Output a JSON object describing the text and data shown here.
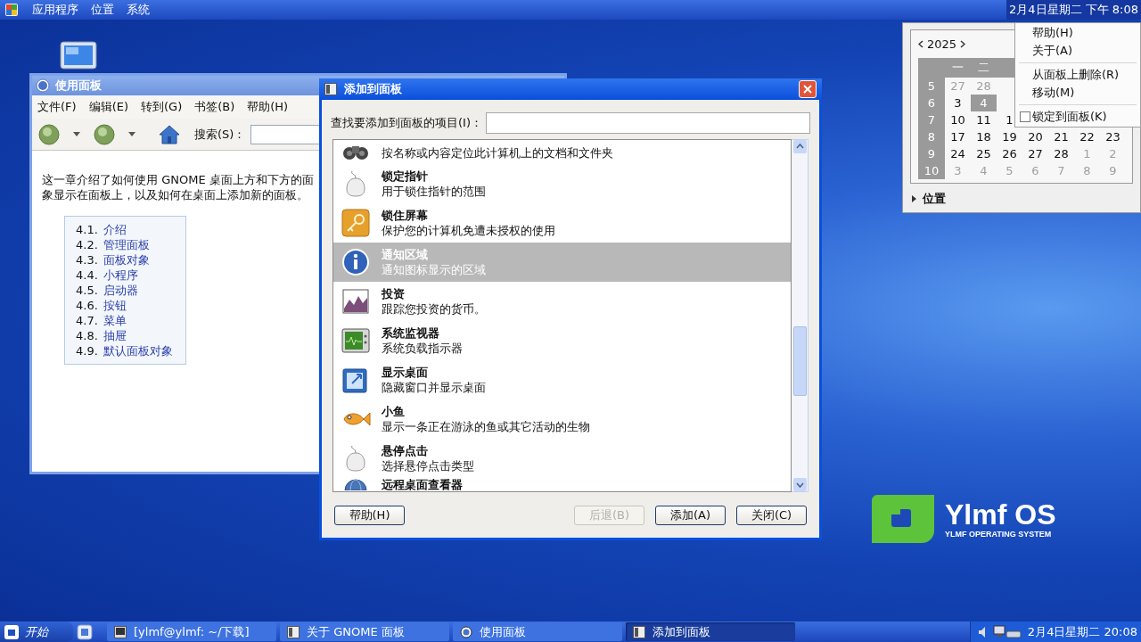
{
  "top_panel": {
    "menus": [
      "应用程序",
      "位置",
      "系统"
    ],
    "clock": "2月4日星期二 下午 8:08",
    "clock_pressed": true
  },
  "help_window": {
    "title": "使用面板",
    "menus": [
      "文件(F)",
      "编辑(E)",
      "转到(G)",
      "书签(B)",
      "帮助(H)"
    ],
    "search_label": "搜索(S)：",
    "paragraph_lines": [
      "这一章介绍了如何使用 GNOME 桌面上方和下方的面",
      "象显示在面板上，以及如何在桌面上添加新的面板。"
    ],
    "toc": [
      {
        "number": "4.1.",
        "label": "介绍"
      },
      {
        "number": "4.2.",
        "label": "管理面板"
      },
      {
        "number": "4.3.",
        "label": "面板对象"
      },
      {
        "number": "4.4.",
        "label": "小程序"
      },
      {
        "number": "4.5.",
        "label": "启动器"
      },
      {
        "number": "4.6.",
        "label": "按钮"
      },
      {
        "number": "4.7.",
        "label": "菜单"
      },
      {
        "number": "4.8.",
        "label": "抽屉"
      },
      {
        "number": "4.9.",
        "label": "默认面板对象"
      }
    ]
  },
  "dialog": {
    "title": "添加到面板",
    "search_label": "查找要添加到面板的项目(I)：",
    "items": [
      {
        "kind": "binoculars",
        "description": "按名称或内容定位此计算机上的文档和文件夹",
        "selected": false
      },
      {
        "kind": "mouse",
        "title": "锁定指针",
        "description": "用于锁住指针的范围",
        "selected": false
      },
      {
        "kind": "key",
        "title": "锁住屏幕",
        "description": "保护您的计算机免遭未授权的使用",
        "selected": false
      },
      {
        "kind": "info",
        "title": "通知区域",
        "description": "通知图标显示的区域",
        "selected": true
      },
      {
        "kind": "chart",
        "title": "投资",
        "description": "跟踪您投资的货币。",
        "selected": false
      },
      {
        "kind": "monitor",
        "title": "系统监视器",
        "description": "系统负载指示器",
        "selected": false
      },
      {
        "kind": "desktop",
        "title": "显示桌面",
        "description": "隐藏窗口并显示桌面",
        "selected": false
      },
      {
        "kind": "fish",
        "title": "小鱼",
        "description": "显示一条正在游泳的鱼或其它活动的生物",
        "selected": false
      },
      {
        "kind": "mouse",
        "title": "悬停点击",
        "description": "选择悬停点击类型",
        "selected": false
      },
      {
        "kind": "globe",
        "title": "远程桌面查看器",
        "selected": false
      }
    ],
    "buttons": [
      {
        "label": "帮助(H)",
        "disabled": false
      },
      {
        "label": "后退(B)",
        "disabled": true
      },
      {
        "label": "添加(A)",
        "disabled": false
      },
      {
        "label": "关闭(C)",
        "disabled": false
      }
    ]
  },
  "calendar": {
    "year": "2025",
    "weekdays": [
      "一",
      "二"
    ],
    "weeks": [
      {
        "number": "5",
        "days": [
          {
            "day": "27",
            "other_month": true,
            "selected": false
          },
          {
            "day": "28",
            "other_month": true,
            "selected": false
          }
        ]
      },
      {
        "number": "6",
        "days": [
          {
            "day": "3",
            "other_month": false,
            "selected": false
          },
          {
            "day": "4",
            "other_month": false,
            "selected": true
          }
        ]
      },
      {
        "number": "7",
        "days": [
          {
            "day": "10",
            "other_month": false,
            "selected": false
          },
          {
            "day": "11",
            "other_month": false,
            "selected": false
          },
          {
            "day": "1",
            "other_month": false,
            "selected": false
          }
        ]
      },
      {
        "number": "8",
        "days": [
          {
            "day": "17",
            "other_month": false,
            "selected": false
          },
          {
            "day": "18",
            "other_month": false,
            "selected": false
          },
          {
            "day": "19",
            "other_month": false,
            "selected": false
          },
          {
            "day": "20",
            "other_month": false,
            "selected": false
          },
          {
            "day": "21",
            "other_month": false,
            "selected": false
          },
          {
            "day": "22",
            "other_month": false,
            "selected": false
          },
          {
            "day": "23",
            "other_month": false,
            "selected": false
          }
        ]
      },
      {
        "number": "9",
        "days": [
          {
            "day": "24",
            "other_month": false,
            "selected": false
          },
          {
            "day": "25",
            "other_month": false,
            "selected": false
          },
          {
            "day": "26",
            "other_month": false,
            "selected": false
          },
          {
            "day": "27",
            "other_month": false,
            "selected": false
          },
          {
            "day": "28",
            "other_month": false,
            "selected": false
          },
          {
            "day": "1",
            "other_month": true,
            "selected": false
          },
          {
            "day": "2",
            "other_month": true,
            "selected": false
          }
        ]
      },
      {
        "number": "10",
        "days": [
          {
            "day": "3",
            "other_month": true,
            "selected": false
          },
          {
            "day": "4",
            "other_month": true,
            "selected": false
          },
          {
            "day": "5",
            "other_month": true,
            "selected": false
          },
          {
            "day": "6",
            "other_month": true,
            "selected": false
          },
          {
            "day": "7",
            "other_month": true,
            "selected": false
          },
          {
            "day": "8",
            "other_month": true,
            "selected": false
          },
          {
            "day": "9",
            "other_month": true,
            "selected": false
          }
        ]
      }
    ],
    "expander": {
      "label": "位置",
      "expanded": false
    }
  },
  "context_menu": {
    "items": [
      {
        "kind": "item",
        "label": "帮助(H)"
      },
      {
        "kind": "item",
        "label": "关于(A)"
      },
      {
        "kind": "separator"
      },
      {
        "kind": "item",
        "label": "从面板上删除(R)"
      },
      {
        "kind": "item",
        "label": "移动(M)"
      },
      {
        "kind": "separator"
      },
      {
        "kind": "check",
        "label": "锁定到面板(K)",
        "checked": false
      }
    ]
  },
  "logo": {
    "name": "Ylmf OS",
    "tagline": "YLMF OPERATING SYSTEM"
  },
  "taskbar": {
    "start": "开始",
    "tasks": [
      {
        "kind": "terminal",
        "label": "[ylmf@ylmf: ~/下载]",
        "selected": false
      },
      {
        "kind": "panel",
        "label": "关于 GNOME 面板",
        "selected": false
      },
      {
        "kind": "help",
        "label": "使用面板",
        "selected": false
      },
      {
        "kind": "panel",
        "label": "添加到面板",
        "selected": true
      }
    ],
    "clock": "2月4日星期二 20:08"
  }
}
